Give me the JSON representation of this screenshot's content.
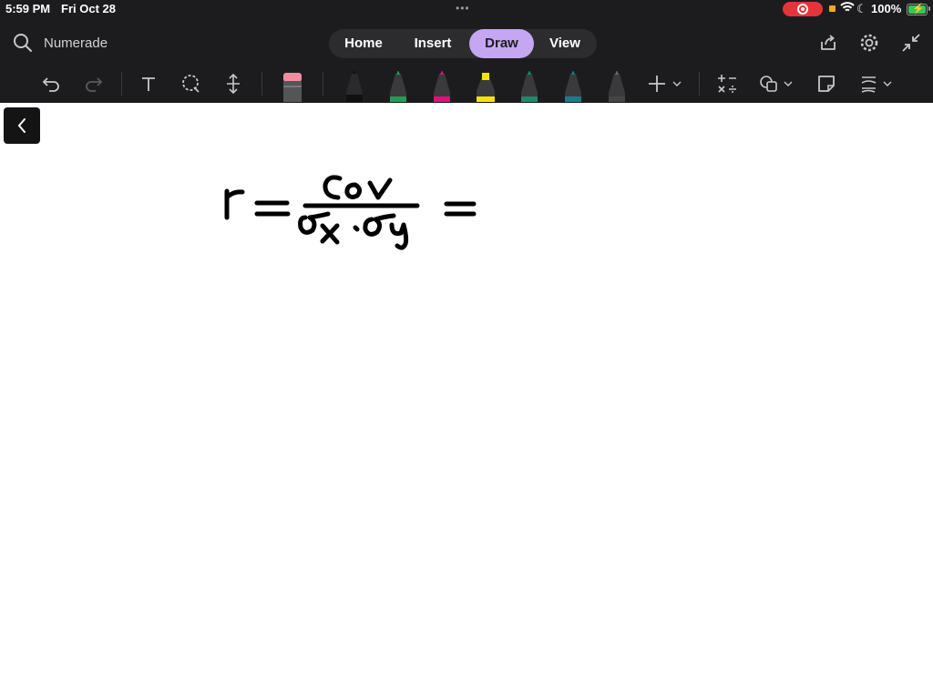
{
  "status_bar": {
    "time": "5:59 PM",
    "date": "Fri Oct 28",
    "more": "•••",
    "battery": "100%"
  },
  "header": {
    "app_title": "Numerade",
    "tabs": [
      {
        "label": "Home"
      },
      {
        "label": "Insert"
      },
      {
        "label": "Draw"
      },
      {
        "label": "View"
      }
    ],
    "active_tab": "Draw"
  },
  "toolbar": {
    "tools": [
      "undo-icon",
      "redo-icon",
      "text-icon",
      "lasso-icon",
      "add-space-icon",
      "eraser-icon",
      "pen-icons",
      "add-pen-icon",
      "math-icon",
      "shapes-icon",
      "sticky-note-icon",
      "ink-style-icon"
    ],
    "pen_colors": [
      "#111111",
      "#1f9d55",
      "#e0117a",
      "#f5e300",
      "#1a8a6a",
      "#1b7d8a",
      "#444444"
    ]
  },
  "colors": {
    "chrome": "#1c1c1e",
    "accent": "#c5a6f0",
    "recording": "#e5343a",
    "battery": "#34c759"
  },
  "canvas": {
    "handwriting_glyphs": "r = Cov / σx·σy ="
  }
}
